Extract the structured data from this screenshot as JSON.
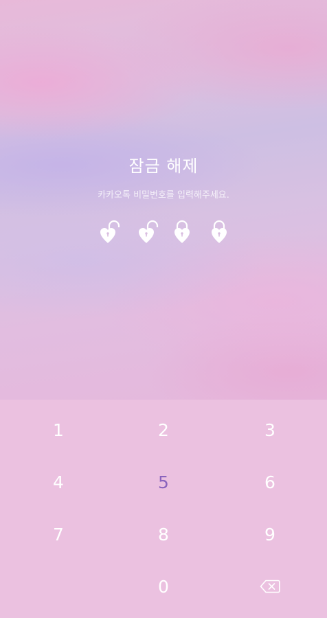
{
  "lock": {
    "title": "잠금 해제",
    "subtitle": "카카오톡 비밀번호를 입력해주세요.",
    "pins_filled": 2,
    "pins_total": 4
  },
  "keypad": {
    "keys": [
      "1",
      "2",
      "3",
      "4",
      "5",
      "6",
      "7",
      "8",
      "9",
      "0"
    ],
    "pressed_key": "5",
    "backspace_icon": "backspace-icon"
  },
  "colors": {
    "keypad_background": "#ebc1e0",
    "pressed_key": "#8a63bd",
    "text": "#ffffff"
  }
}
